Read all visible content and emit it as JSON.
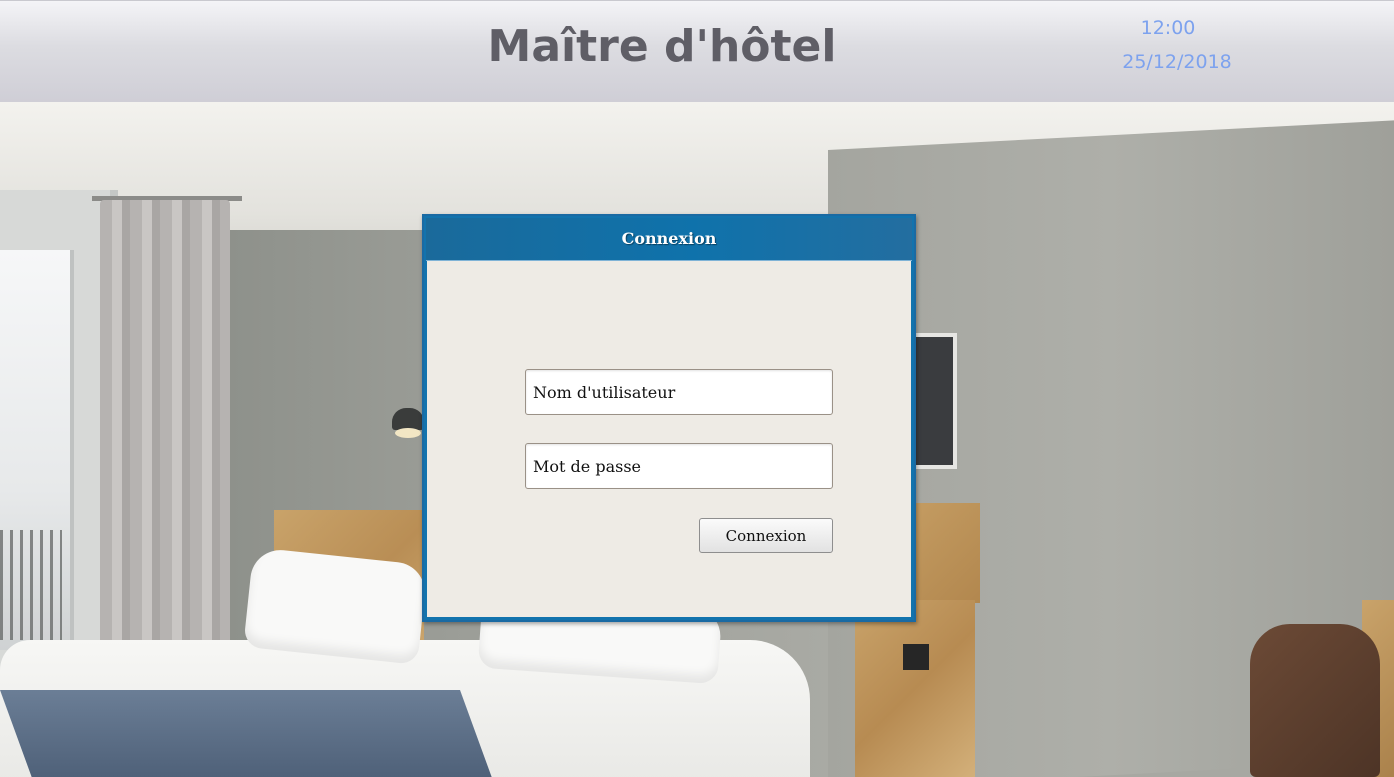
{
  "header": {
    "title": "Maître d'hôtel",
    "time": "12:00",
    "date": "25/12/2018"
  },
  "login_dialog": {
    "title": "Connexion",
    "username_placeholder": "Nom d'utilisateur",
    "password_placeholder": "Mot de passe",
    "submit_label": "Connexion"
  },
  "colors": {
    "header_title": "#5f5e66",
    "clock": "#7da2ee",
    "dialog_header": "#1273ad",
    "dialog_body": "#eeebe5"
  }
}
